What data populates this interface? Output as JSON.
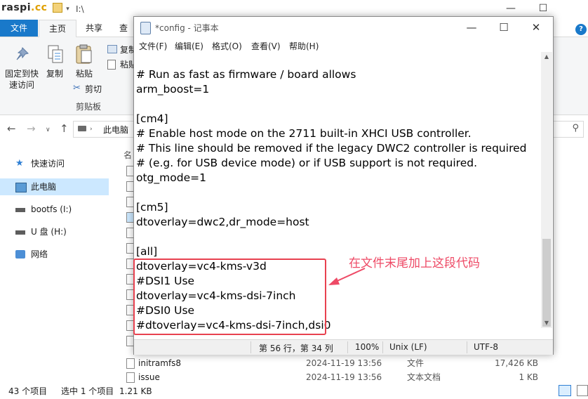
{
  "explorer": {
    "watermark": {
      "part1": "raspi",
      "part2": ".cc"
    },
    "path_text": "I:\\",
    "window_controls": {
      "minimize": "—",
      "maximize": "☐"
    },
    "ribbon_tabs": {
      "file": "文件",
      "home": "主页",
      "share": "共享",
      "view": "查看",
      "help": "?"
    },
    "ribbon": {
      "pin_label_1": "固定到快",
      "pin_label_2": "速访问",
      "copy_label": "复制",
      "paste_label": "粘贴",
      "cut_label": "剪切",
      "copy_path_label": "复制",
      "paste_shortcut_label": "粘贴",
      "group_label": "剪贴板"
    },
    "address": {
      "location": "此电脑"
    },
    "column_header": "名",
    "nav_items": [
      {
        "label": "快速访问",
        "icon": "star-icon"
      },
      {
        "label": "此电脑",
        "icon": "computer-icon"
      },
      {
        "label": "bootfs (I:)",
        "icon": "drive-icon"
      },
      {
        "label": "U 盘 (H:)",
        "icon": "usb-drive-icon"
      },
      {
        "label": "网络",
        "icon": "network-icon"
      }
    ],
    "files": [
      {
        "name": "initramfs8",
        "date": "2024-11-19 13:56",
        "type": "文件",
        "size": "17,426 KB"
      },
      {
        "name": "issue",
        "date": "2024-11-19 13:56",
        "type": "文本文档",
        "size": "1 KB"
      }
    ],
    "status": {
      "count": "43 个项目",
      "selected": "选中 1 个项目",
      "size": "1.21 KB"
    }
  },
  "notepad": {
    "title": "*config - 记事本",
    "window_controls": {
      "minimize": "—",
      "maximize": "☐",
      "close": "✕"
    },
    "menu": [
      "文件(F)",
      "编辑(E)",
      "格式(O)",
      "查看(V)",
      "帮助(H)"
    ],
    "content": "# Run as fast as firmware / board allows\narm_boost=1\n\n[cm4]\n# Enable host mode on the 2711 built-in XHCI USB controller.\n# This line should be removed if the legacy DWC2 controller is required\n# (e.g. for USB device mode) or if USB support is not required.\notg_mode=1\n\n[cm5]\ndtoverlay=dwc2,dr_mode=host\n\n[all]\ndtoverlay=vc4-kms-v3d\n#DSI1 Use\ndtoverlay=vc4-kms-dsi-7inch\n#DSI0 Use\n#dtoverlay=vc4-kms-dsi-7inch,dsi0",
    "status": {
      "position": "第 56 行，第 34 列",
      "zoom": "100%",
      "line_ending": "Unix (LF)",
      "encoding": "UTF-8"
    }
  },
  "annotation": {
    "text": "在文件末尾加上这段代码",
    "color": "#e8414f"
  },
  "colors": {
    "accent": "#1979ca",
    "selection": "#cce8ff"
  }
}
